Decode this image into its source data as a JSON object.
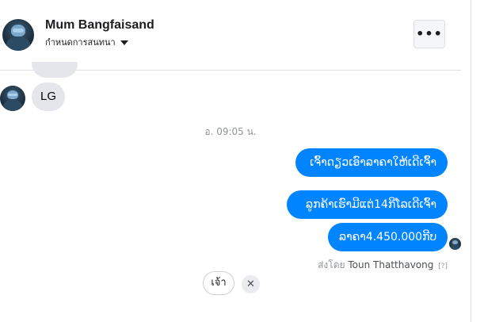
{
  "header": {
    "contact_name": "Mum Bangfaisand",
    "conversation_settings_label": "กำหนดการสนทนา",
    "more_icon": "more-horizontal-icon"
  },
  "messages": {
    "incoming": [
      {
        "text": ""
      },
      {
        "text": "LG"
      }
    ],
    "timestamp": "อ. 09:05 น.",
    "outgoing": [
      {
        "text": "ເຈົ້າດຽວເອົາລາຄາໃຫ້ເດີເຈົ້າ"
      },
      {
        "text": "ລູກຄ້າເຮົາມີແຕ່14ກີໂລເດີເຈົ້າ"
      },
      {
        "text": "ລາຄາ4.450.000ກີບ"
      }
    ],
    "sent_by_prefix": "ส่งโดย",
    "sent_by_name": "Toun Thatthavong",
    "sent_by_help": "[?]"
  },
  "quick_reply": {
    "label": "เจ้า",
    "dismiss_symbol": "✕"
  }
}
